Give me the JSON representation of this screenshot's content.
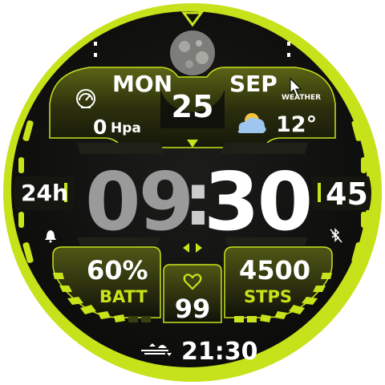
{
  "date": {
    "weekday": "MON",
    "month": "SEP",
    "day": "25"
  },
  "pressure": {
    "value": "0",
    "unit": "Hpa",
    "icon": "speedometer-icon"
  },
  "weather": {
    "label": "WEATHER",
    "temp": "12°",
    "icon": "partly-cloudy-icon"
  },
  "time": {
    "hours": "09",
    "separator": ":",
    "minutes": "30",
    "seconds": "45",
    "format": "24h"
  },
  "battery": {
    "percent": "60%",
    "label": "BATT",
    "level": 0.6
  },
  "steps": {
    "count": "4500",
    "label": "STPS"
  },
  "heart": {
    "rate": "99",
    "icon": "heart-icon"
  },
  "sunset": {
    "time": "21:30",
    "icon": "sunset-icon"
  },
  "moon": {
    "icon": "moon-phase-icon"
  },
  "colors": {
    "accent": "#c8e31a",
    "bezel": "#c6e21b",
    "background": "#0d0e0c",
    "text": "#ffffff",
    "dim_digits": "#9a9a9a"
  }
}
